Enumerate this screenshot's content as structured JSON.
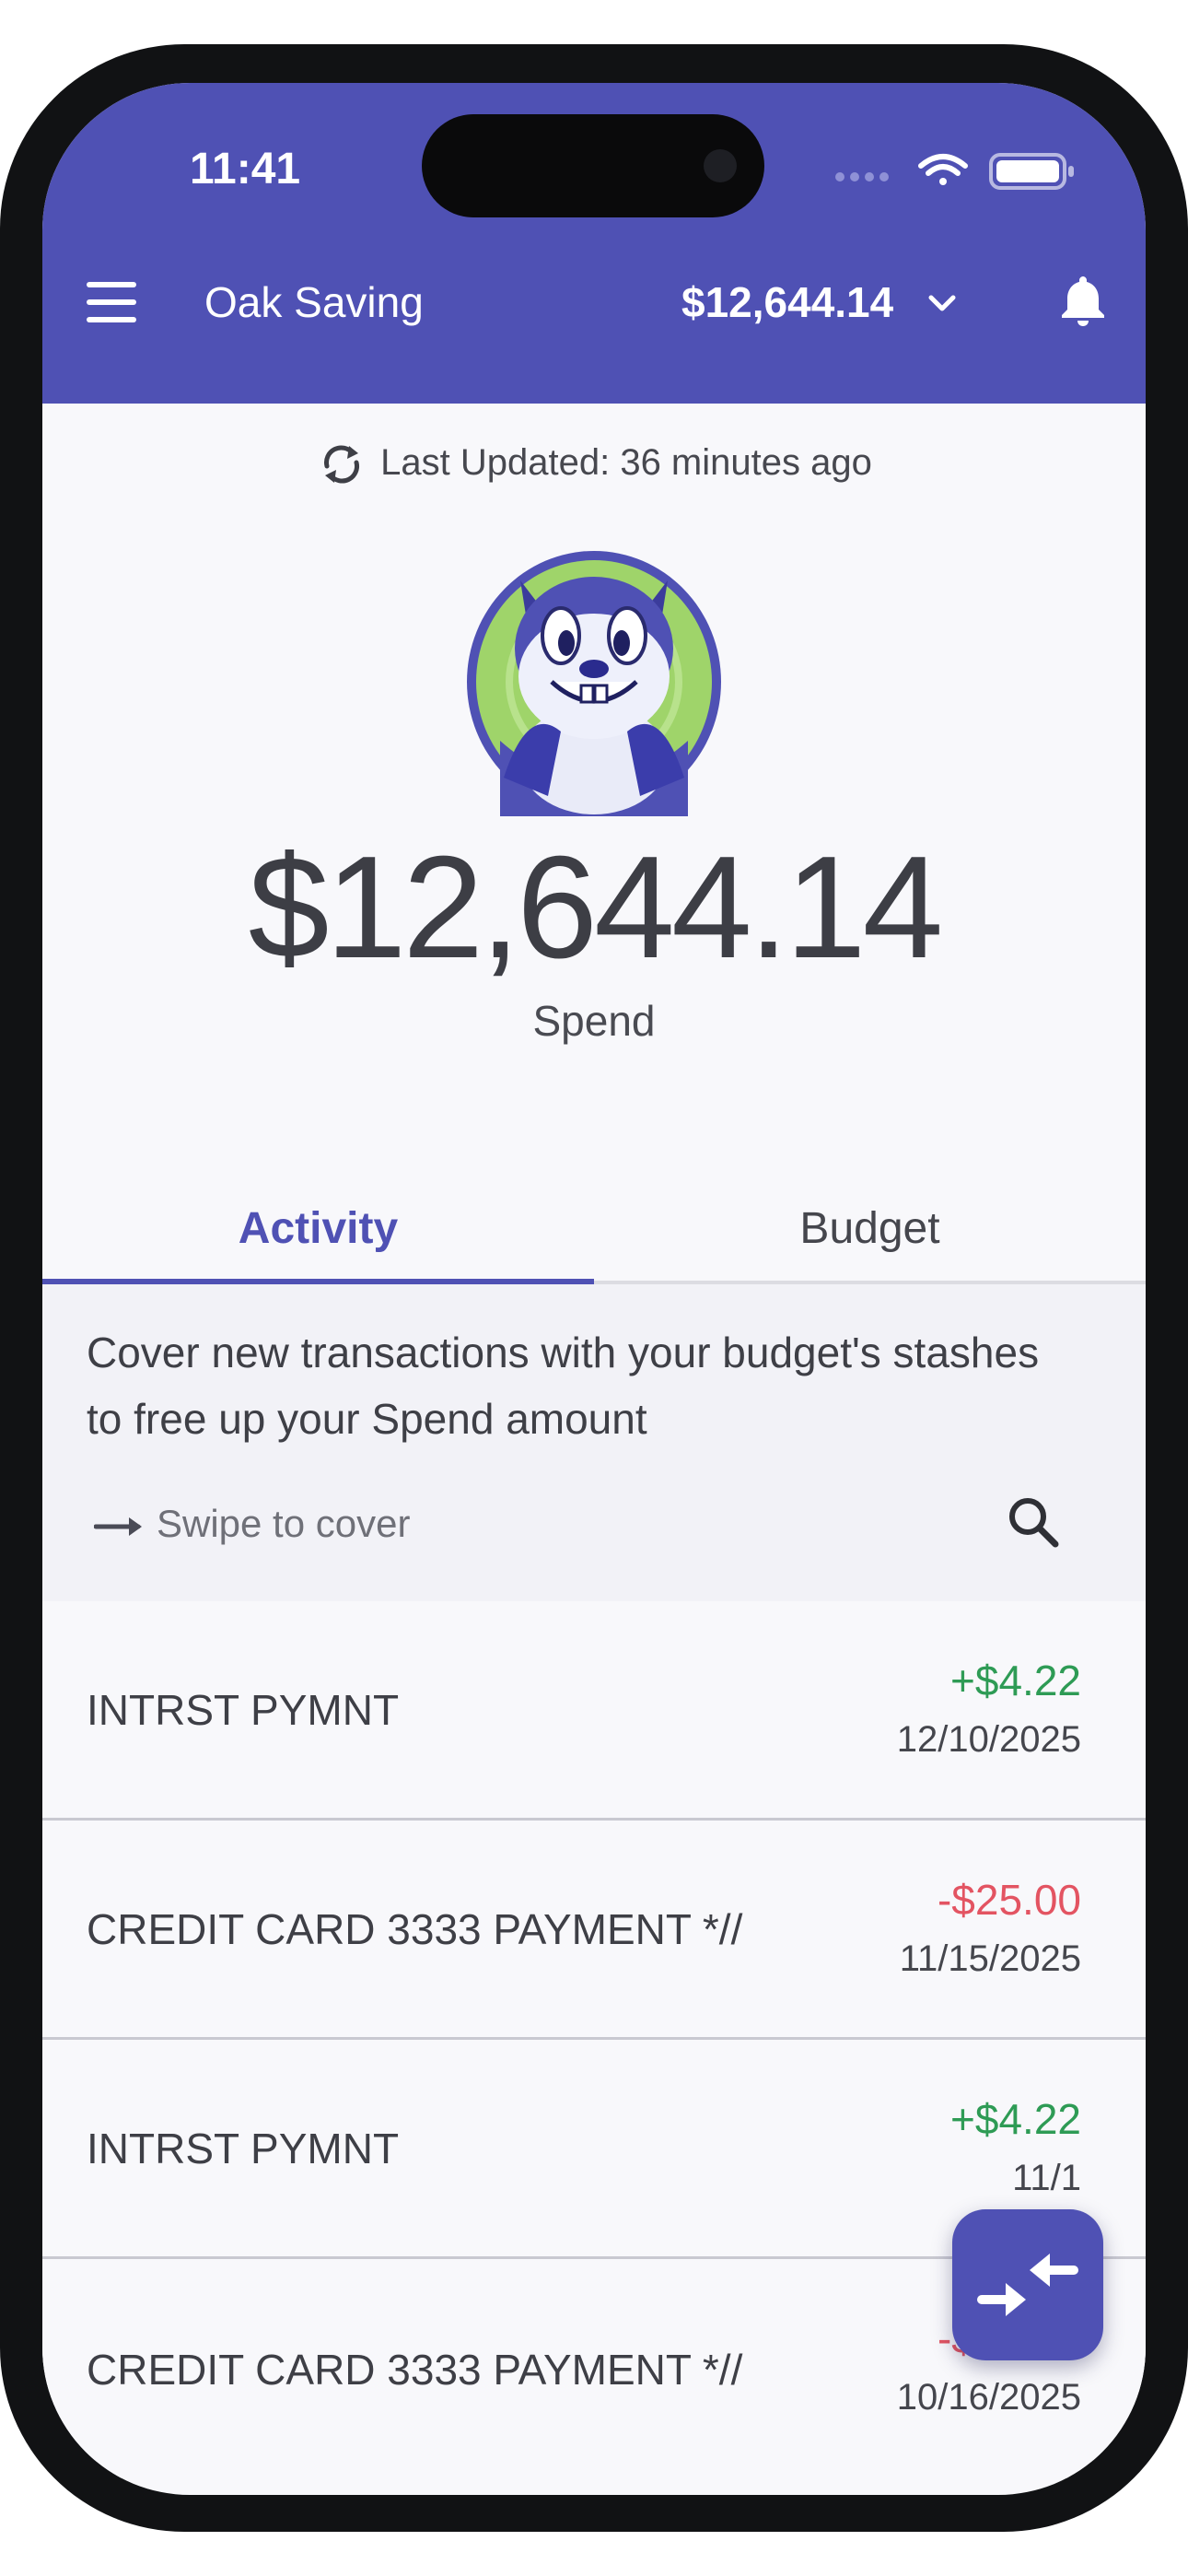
{
  "status_bar": {
    "time": "11:41"
  },
  "header": {
    "title": "Oak Saving",
    "balance": "$12,644.14"
  },
  "summary": {
    "last_updated": "Last Updated: 36 minutes ago",
    "balance": "$12,644.14",
    "label": "Spend"
  },
  "tabs": [
    {
      "label": "Activity",
      "active": true
    },
    {
      "label": "Budget",
      "active": false
    }
  ],
  "info": {
    "message": "Cover new transactions with your budget's stashes to free up your Spend amount",
    "swipe_hint": "Swipe to cover"
  },
  "transactions": [
    {
      "name": "INTRST PYMNT",
      "amount": "+$4.22",
      "date": "12/10/2025",
      "type": "credit"
    },
    {
      "name": "CREDIT CARD 3333 PAYMENT *//",
      "amount": "-$25.00",
      "date": "11/15/2025",
      "type": "debit"
    },
    {
      "name": "INTRST PYMNT",
      "amount": "+$4.22",
      "date": "11/1",
      "type": "credit"
    },
    {
      "name": "CREDIT CARD 3333 PAYMENT *//",
      "amount": "-$25.00",
      "date": "10/16/2025",
      "type": "debit"
    }
  ],
  "colors": {
    "accent": "#4f51b4",
    "credit": "#2e9b55",
    "debit": "#e35462"
  },
  "icons": {
    "menu": "hamburger-icon",
    "dropdown": "chevron-down-icon",
    "notifications": "bell-icon",
    "refresh": "refresh-icon",
    "swipe": "arrow-right-icon",
    "search": "search-icon",
    "fab": "cover-arrows-icon"
  }
}
